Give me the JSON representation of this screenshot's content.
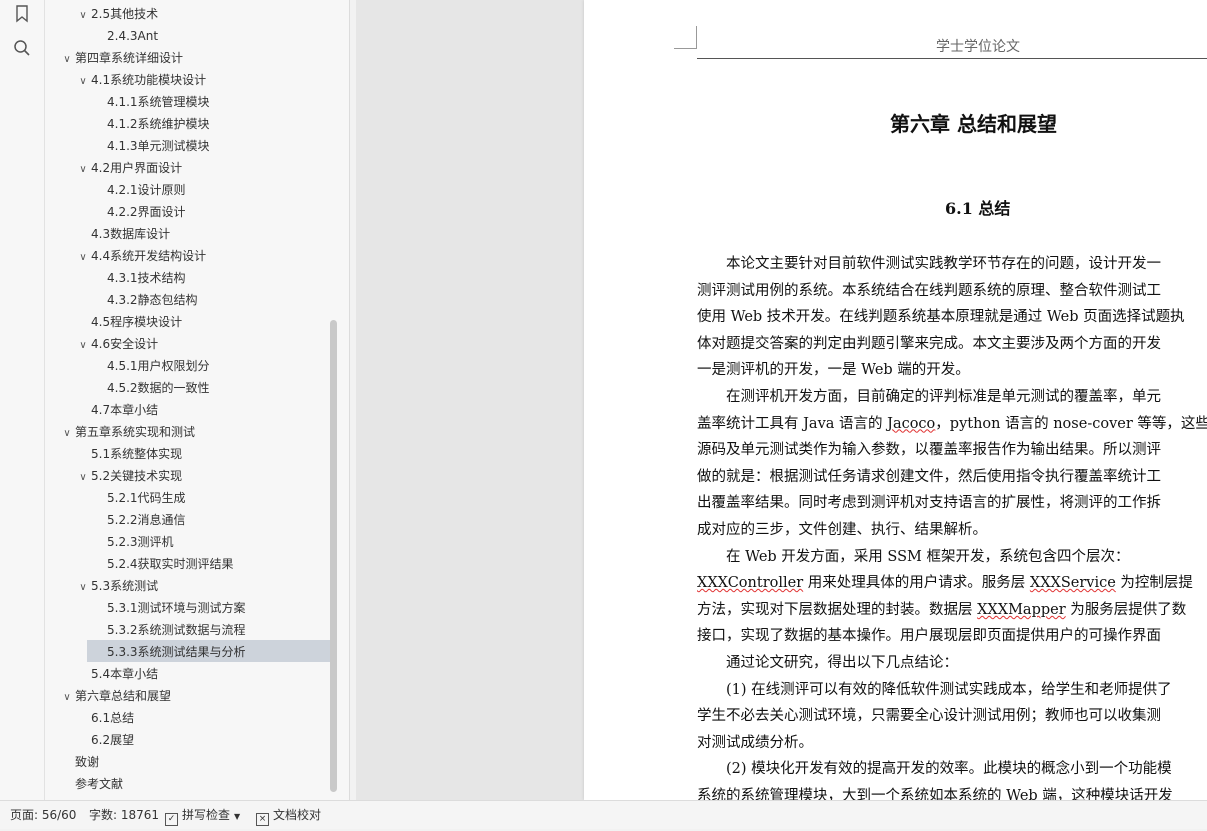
{
  "toc": [
    {
      "label": "2.5其他技术",
      "level": 1,
      "expanded": true
    },
    {
      "label": "2.4.3Ant",
      "level": 2
    },
    {
      "label": "第四章系统详细设计",
      "level": 0,
      "expanded": true
    },
    {
      "label": "4.1系统功能模块设计",
      "level": 1,
      "expanded": true
    },
    {
      "label": "4.1.1系统管理模块",
      "level": 2
    },
    {
      "label": "4.1.2系统维护模块",
      "level": 2
    },
    {
      "label": "4.1.3单元测试模块",
      "level": 2
    },
    {
      "label": "4.2用户界面设计",
      "level": 1,
      "expanded": true
    },
    {
      "label": "4.2.1设计原则",
      "level": 2
    },
    {
      "label": "4.2.2界面设计",
      "level": 2
    },
    {
      "label": "4.3数据库设计",
      "level": 1
    },
    {
      "label": "4.4系统开发结构设计",
      "level": 1,
      "expanded": true
    },
    {
      "label": "4.3.1技术结构",
      "level": 2
    },
    {
      "label": "4.3.2静态包结构",
      "level": 2
    },
    {
      "label": "4.5程序模块设计",
      "level": 1
    },
    {
      "label": "4.6安全设计",
      "level": 1,
      "expanded": true
    },
    {
      "label": "4.5.1用户权限划分",
      "level": 2
    },
    {
      "label": "4.5.2数据的一致性",
      "level": 2
    },
    {
      "label": "4.7本章小结",
      "level": 1
    },
    {
      "label": "第五章系统实现和测试",
      "level": 0,
      "expanded": true
    },
    {
      "label": "5.1系统整体实现",
      "level": 1
    },
    {
      "label": "5.2关键技术实现",
      "level": 1,
      "expanded": true
    },
    {
      "label": "5.2.1代码生成",
      "level": 2
    },
    {
      "label": "5.2.2消息通信",
      "level": 2
    },
    {
      "label": "5.2.3测评机",
      "level": 2
    },
    {
      "label": "5.2.4获取实时测评结果",
      "level": 2
    },
    {
      "label": "5.3系统测试",
      "level": 1,
      "expanded": true
    },
    {
      "label": "5.3.1测试环境与测试方案",
      "level": 2
    },
    {
      "label": "5.3.2系统测试数据与流程",
      "level": 2
    },
    {
      "label": "5.3.3系统测试结果与分析",
      "level": 2,
      "selected": true
    },
    {
      "label": "5.4本章小结",
      "level": 1
    },
    {
      "label": "第六章总结和展望",
      "level": 0,
      "expanded": true
    },
    {
      "label": "6.1总结",
      "level": 1
    },
    {
      "label": "6.2展望",
      "level": 1
    },
    {
      "label": "致谢",
      "level": 0
    },
    {
      "label": "参考文献",
      "level": 0
    }
  ],
  "document": {
    "header": "学士学位论文",
    "chapter_title": "第六章 总结和展望",
    "section_title": "6.1 总结",
    "lines": [
      {
        "text": "　　本论文主要针对目前软件测试实践教学环节存在的问题，设计开发一"
      },
      {
        "text": "测评测试用例的系统。本系统结合在线判题系统的原理、整合软件测试工"
      },
      {
        "text": "使用 Web 技术开发。在线判题系统基本原理就是通过 Web 页面选择试题执"
      },
      {
        "text": "体对题提交答案的判定由判题引擎来完成。本文主要涉及两个方面的开发"
      },
      {
        "text": "一是测评机的开发，一是 Web 端的开发。"
      },
      {
        "text": "　　在测评机开发方面，目前确定的评判标准是单元测试的覆盖率，单元"
      },
      {
        "text": "盖率统计工具有 Java 语言的 Jacoco，python 语言的 nose-cover 等等，这些",
        "squig": "Jacoco"
      },
      {
        "text": "源码及单元测试类作为输入参数，以覆盖率报告作为输出结果。所以测评"
      },
      {
        "text": "做的就是：根据测试任务请求创建文件，然后使用指令执行覆盖率统计工"
      },
      {
        "text": "出覆盖率结果。同时考虑到测评机对支持语言的扩展性，将测评的工作拆"
      },
      {
        "text": "成对应的三步，文件创建、执行、结果解析。"
      },
      {
        "text": "　　在 Web 开发方面，采用 SSM 框架开发，系统包含四个层次："
      },
      {
        "text": "XXXController 用来处理具体的用户请求。服务层 XXXService 为控制层提",
        "squig": "XXXController|XXXService"
      },
      {
        "text": "方法，实现对下层数据处理的封装。数据层 XXXMapper 为服务层提供了数",
        "squig": "XXXMapper"
      },
      {
        "text": "接口，实现了数据的基本操作。用户展现层即页面提供用户的可操作界面"
      },
      {
        "text": "　　通过论文研究，得出以下几点结论："
      },
      {
        "text": "　　(1) 在线测评可以有效的降低软件测试实践成本，给学生和老师提供了"
      },
      {
        "text": "学生不必去关心测试环境，只需要全心设计测试用例；教师也可以收集测"
      },
      {
        "text": "对测试成绩分析。"
      },
      {
        "text": "　　(2) 模块化开发有效的提高开发的效率。此模块的概念小到一个功能模"
      },
      {
        "text": "系统的系统管理模块，大到一个系统如本系统的 Web 端，这种模块话开发"
      }
    ]
  },
  "statusbar": {
    "page": "页面: 56/60",
    "words": "字数: 18761",
    "spellcheck": "拼写检查",
    "proofread": "文档校对"
  }
}
